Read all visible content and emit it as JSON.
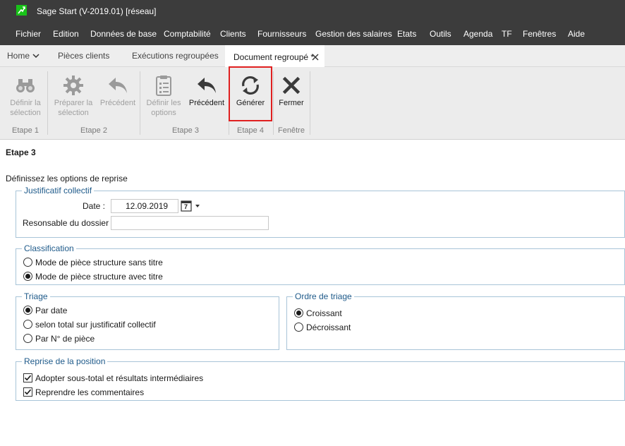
{
  "window": {
    "title": "Sage Start (V-2019.01) [réseau]",
    "logo_icon": "sage-logo-icon",
    "accent": "#19c319"
  },
  "menu": {
    "items": [
      "Fichier",
      "Edition",
      "Données de base",
      "Comptabilité",
      "Clients",
      "Fournisseurs",
      "Gestion des salaires",
      "Etats",
      "Outils",
      "Agenda",
      "TF",
      "Fenêtres",
      "Aide"
    ]
  },
  "tabs": {
    "home": "Home",
    "items": [
      "Pièces clients",
      "Exécutions regroupées",
      "Document regroupé *"
    ],
    "active_index": 2
  },
  "ribbon": {
    "buttons": {
      "define_selection": {
        "label": "Définir la sélection",
        "icon": "binoculars-icon",
        "enabled": false
      },
      "prepare_selection": {
        "label": "Préparer la sélection",
        "icon": "gear-icon",
        "enabled": false
      },
      "previous_1": {
        "label": "Précédent",
        "icon": "back-arrow-icon",
        "enabled": false
      },
      "define_options": {
        "label": "Définir les options",
        "icon": "clipboard-list-icon",
        "enabled": false
      },
      "previous_2": {
        "label": "Précédent",
        "icon": "back-arrow-icon",
        "enabled": true
      },
      "generate": {
        "label": "Générer",
        "icon": "refresh-icon",
        "enabled": true
      },
      "close": {
        "label": "Fermer",
        "icon": "close-x-icon",
        "enabled": true
      }
    },
    "groups": [
      "Etape 1",
      "Etape 2",
      "Etape 3",
      "Etape 4",
      "Fenêtre"
    ],
    "highlight_color": "#e02020"
  },
  "step": {
    "title": "Etape 3",
    "description": "Définissez les options de reprise"
  },
  "justificatif": {
    "legend": "Justificatif collectif",
    "date_label": "Date :",
    "date_value": "12.09.2019",
    "calendar_day": "7",
    "responsable_label": "Resonsable du dossier :",
    "responsable_value": ""
  },
  "classification": {
    "legend": "Classification",
    "options": [
      "Mode de pièce structure sans titre",
      "Mode de pièce structure avec titre"
    ],
    "selected": 1
  },
  "triage": {
    "legend": "Triage",
    "options": [
      "Par date",
      "selon total sur justificatif collectif",
      "Par N° de pièce"
    ],
    "selected": 0
  },
  "ordre": {
    "legend": "Ordre de triage",
    "options": [
      "Croissant",
      "Décroissant"
    ],
    "selected": 0
  },
  "reprise": {
    "legend": "Reprise de la position",
    "checks": [
      {
        "label": "Adopter sous-total et résultats intermédiaires",
        "checked": true
      },
      {
        "label": "Reprendre les commentaires",
        "checked": true
      }
    ]
  }
}
